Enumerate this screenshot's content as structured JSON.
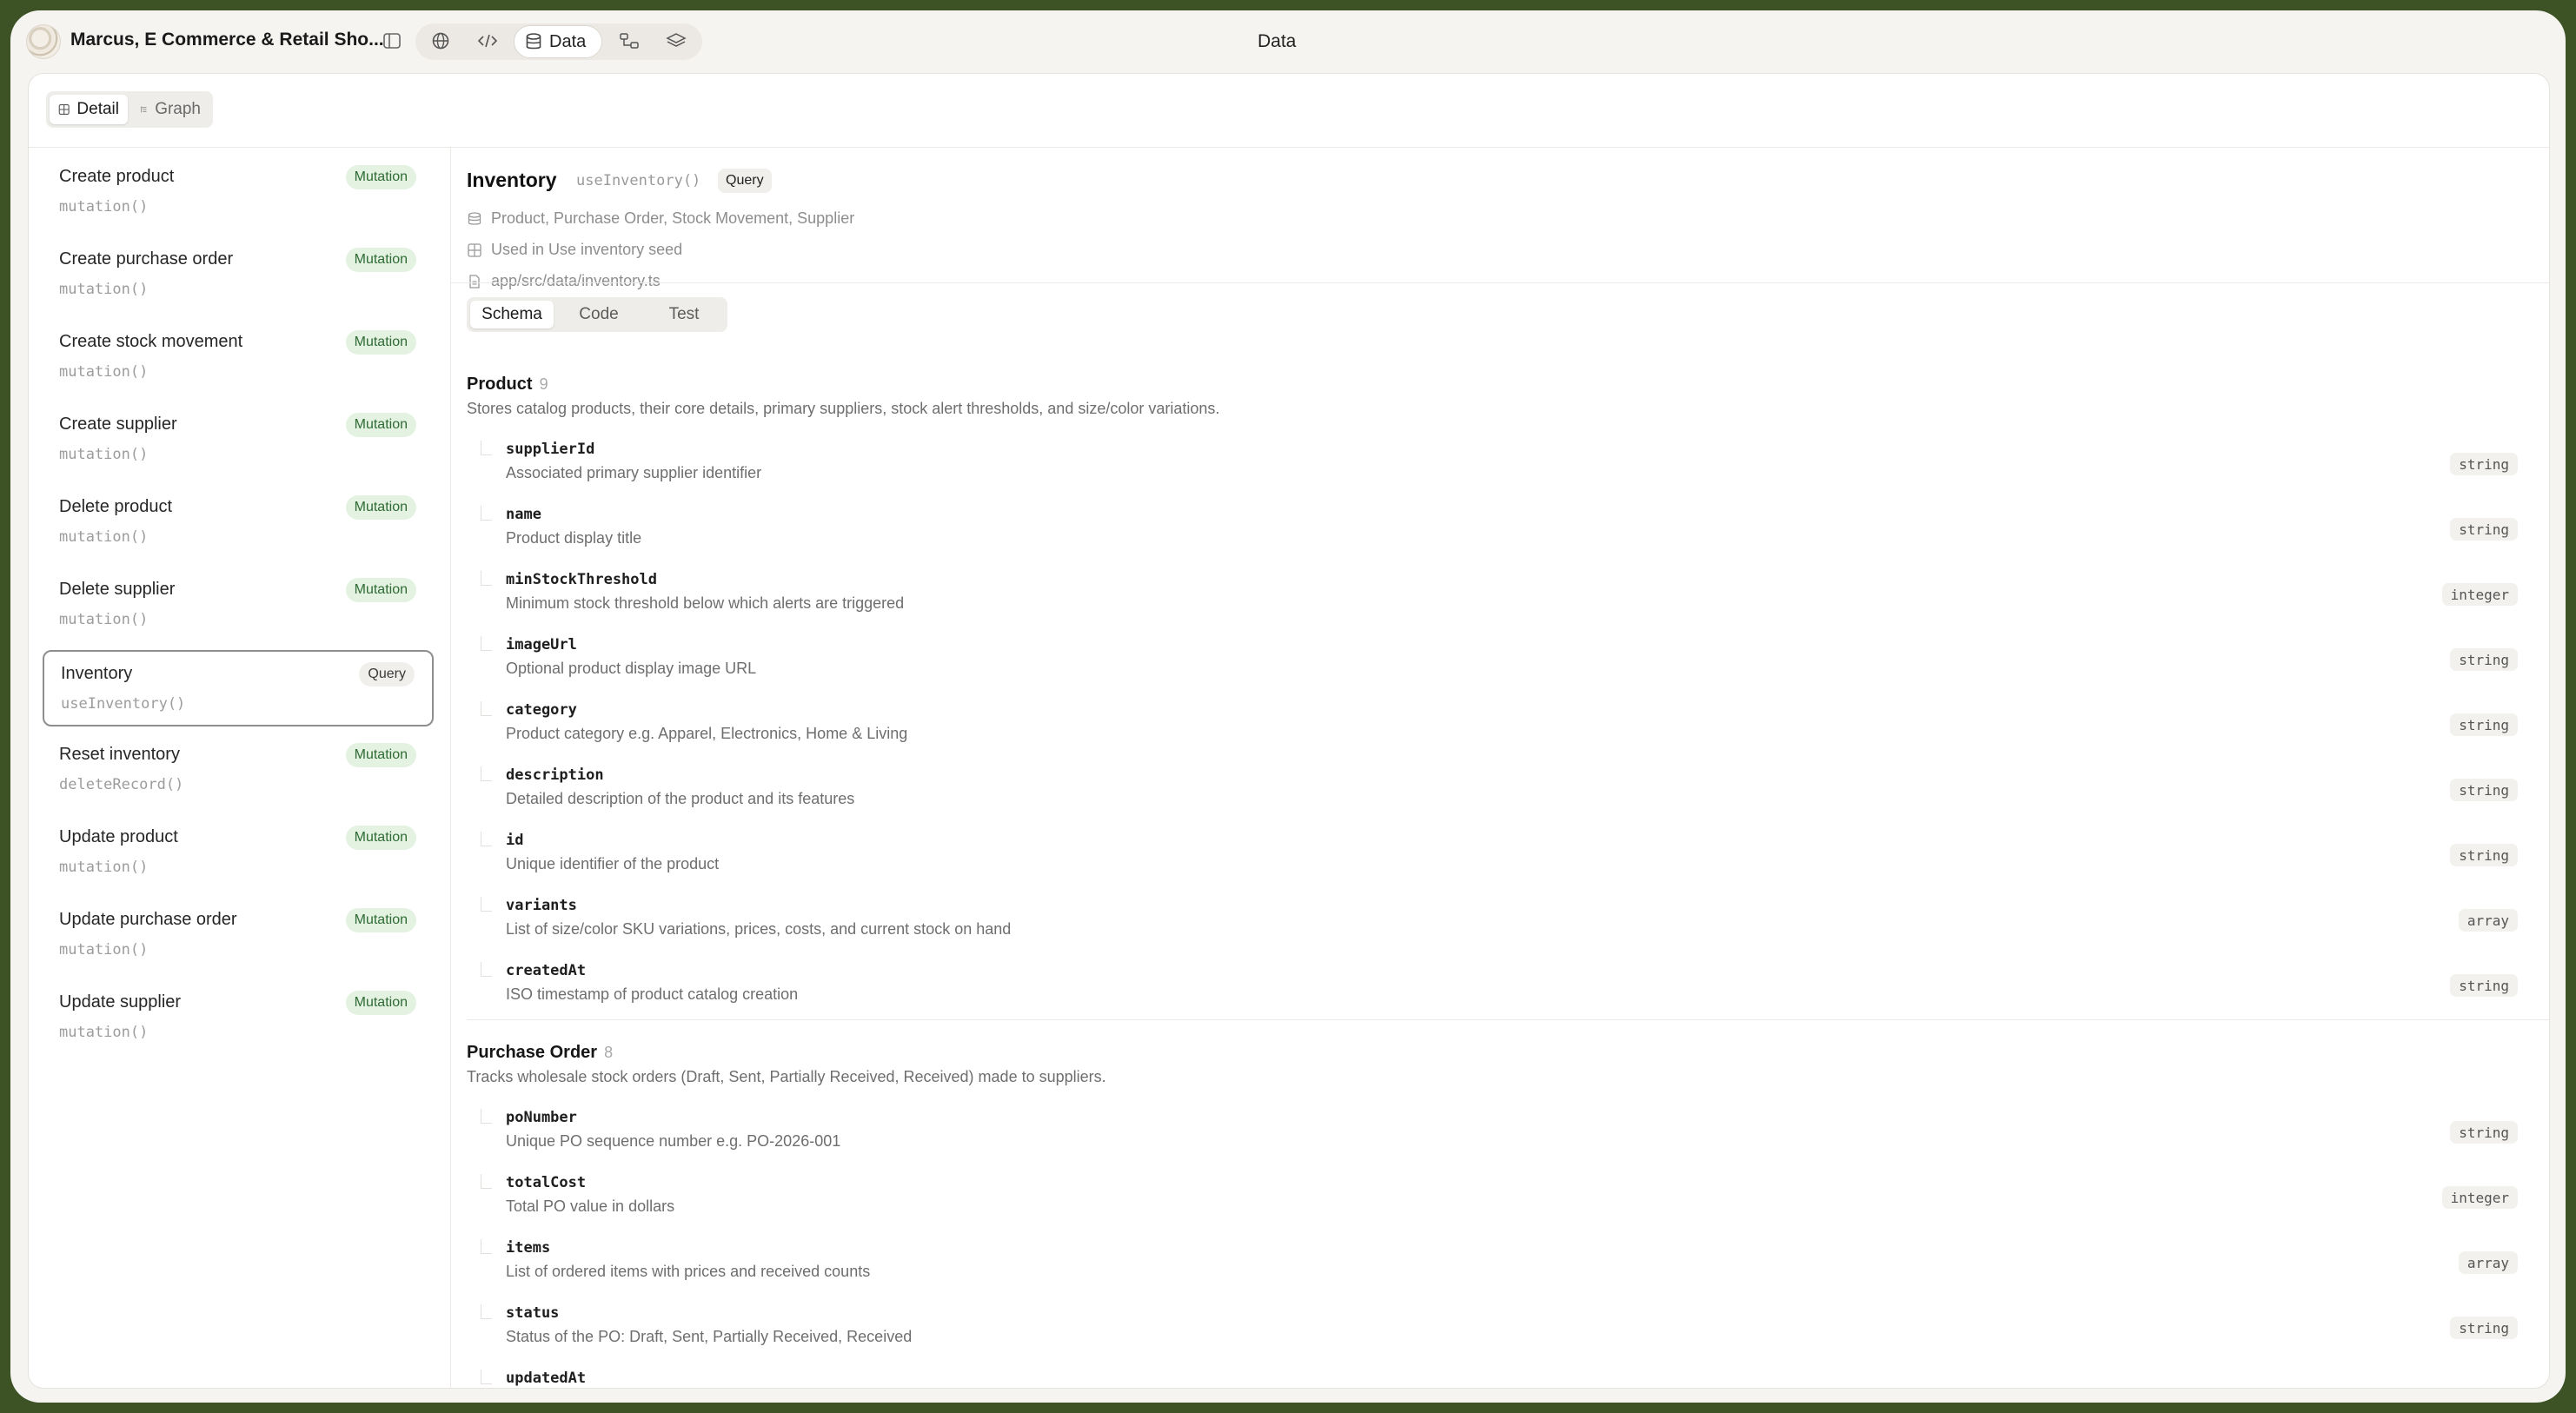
{
  "topbar": {
    "app_title": "Marcus, E Commerce & Retail Sho...",
    "center_title": "Data",
    "data_tab_label": "Data",
    "icons": [
      "app-logo",
      "sidebar-toggle-icon",
      "globe-icon",
      "code-icon",
      "database-icon",
      "flow-icon",
      "layers-icon"
    ]
  },
  "view_toggle": {
    "detail_label": "Detail",
    "graph_label": "Graph"
  },
  "sidebar": {
    "items": [
      {
        "name": "Create product",
        "code": "mutation()",
        "badge": "Mutation"
      },
      {
        "name": "Create purchase order",
        "code": "mutation()",
        "badge": "Mutation"
      },
      {
        "name": "Create stock movement",
        "code": "mutation()",
        "badge": "Mutation"
      },
      {
        "name": "Create supplier",
        "code": "mutation()",
        "badge": "Mutation"
      },
      {
        "name": "Delete product",
        "code": "mutation()",
        "badge": "Mutation"
      },
      {
        "name": "Delete supplier",
        "code": "mutation()",
        "badge": "Mutation"
      },
      {
        "name": "Inventory",
        "code": "useInventory()",
        "badge": "Query"
      },
      {
        "name": "Reset inventory",
        "code": "deleteRecord()",
        "badge": "Mutation"
      },
      {
        "name": "Update product",
        "code": "mutation()",
        "badge": "Mutation"
      },
      {
        "name": "Update purchase order",
        "code": "mutation()",
        "badge": "Mutation"
      },
      {
        "name": "Update supplier",
        "code": "mutation()",
        "badge": "Mutation"
      }
    ]
  },
  "main": {
    "title": "Inventory",
    "func": "useInventory()",
    "badge": "Query",
    "entities_line": "Product, Purchase Order, Stock Movement, Supplier",
    "used_in": "Used in Use inventory seed",
    "file_path": "app/src/data/inventory.ts",
    "tabs": [
      "Schema",
      "Code",
      "Test"
    ]
  },
  "entities": [
    {
      "title": "Product",
      "count": "9",
      "description": "Stores catalog products, their core details, primary suppliers, stock alert thresholds, and size/color variations.",
      "fields": [
        {
          "name": "supplierId",
          "desc": "Associated primary supplier identifier",
          "type": "string"
        },
        {
          "name": "name",
          "desc": "Product display title",
          "type": "string"
        },
        {
          "name": "minStockThreshold",
          "desc": "Minimum stock threshold below which alerts are triggered",
          "type": "integer"
        },
        {
          "name": "imageUrl",
          "desc": "Optional product display image URL",
          "type": "string"
        },
        {
          "name": "category",
          "desc": "Product category e.g. Apparel, Electronics, Home & Living",
          "type": "string"
        },
        {
          "name": "description",
          "desc": "Detailed description of the product and its features",
          "type": "string"
        },
        {
          "name": "id",
          "desc": "Unique identifier of the product",
          "type": "string"
        },
        {
          "name": "variants",
          "desc": "List of size/color SKU variations, prices, costs, and current stock on hand",
          "type": "array"
        },
        {
          "name": "createdAt",
          "desc": "ISO timestamp of product catalog creation",
          "type": "string"
        }
      ]
    },
    {
      "title": "Purchase Order",
      "count": "8",
      "description": "Tracks wholesale stock orders (Draft, Sent, Partially Received, Received) made to suppliers.",
      "fields": [
        {
          "name": "poNumber",
          "desc": "Unique PO sequence number e.g. PO-2026-001",
          "type": "string"
        },
        {
          "name": "totalCost",
          "desc": "Total PO value in dollars",
          "type": "integer"
        },
        {
          "name": "items",
          "desc": "List of ordered items with prices and received counts",
          "type": "array"
        },
        {
          "name": "status",
          "desc": "Status of the PO: Draft, Sent, Partially Received, Received",
          "type": "string"
        },
        {
          "name": "updatedAt",
          "desc": "",
          "type": ""
        }
      ]
    }
  ]
}
